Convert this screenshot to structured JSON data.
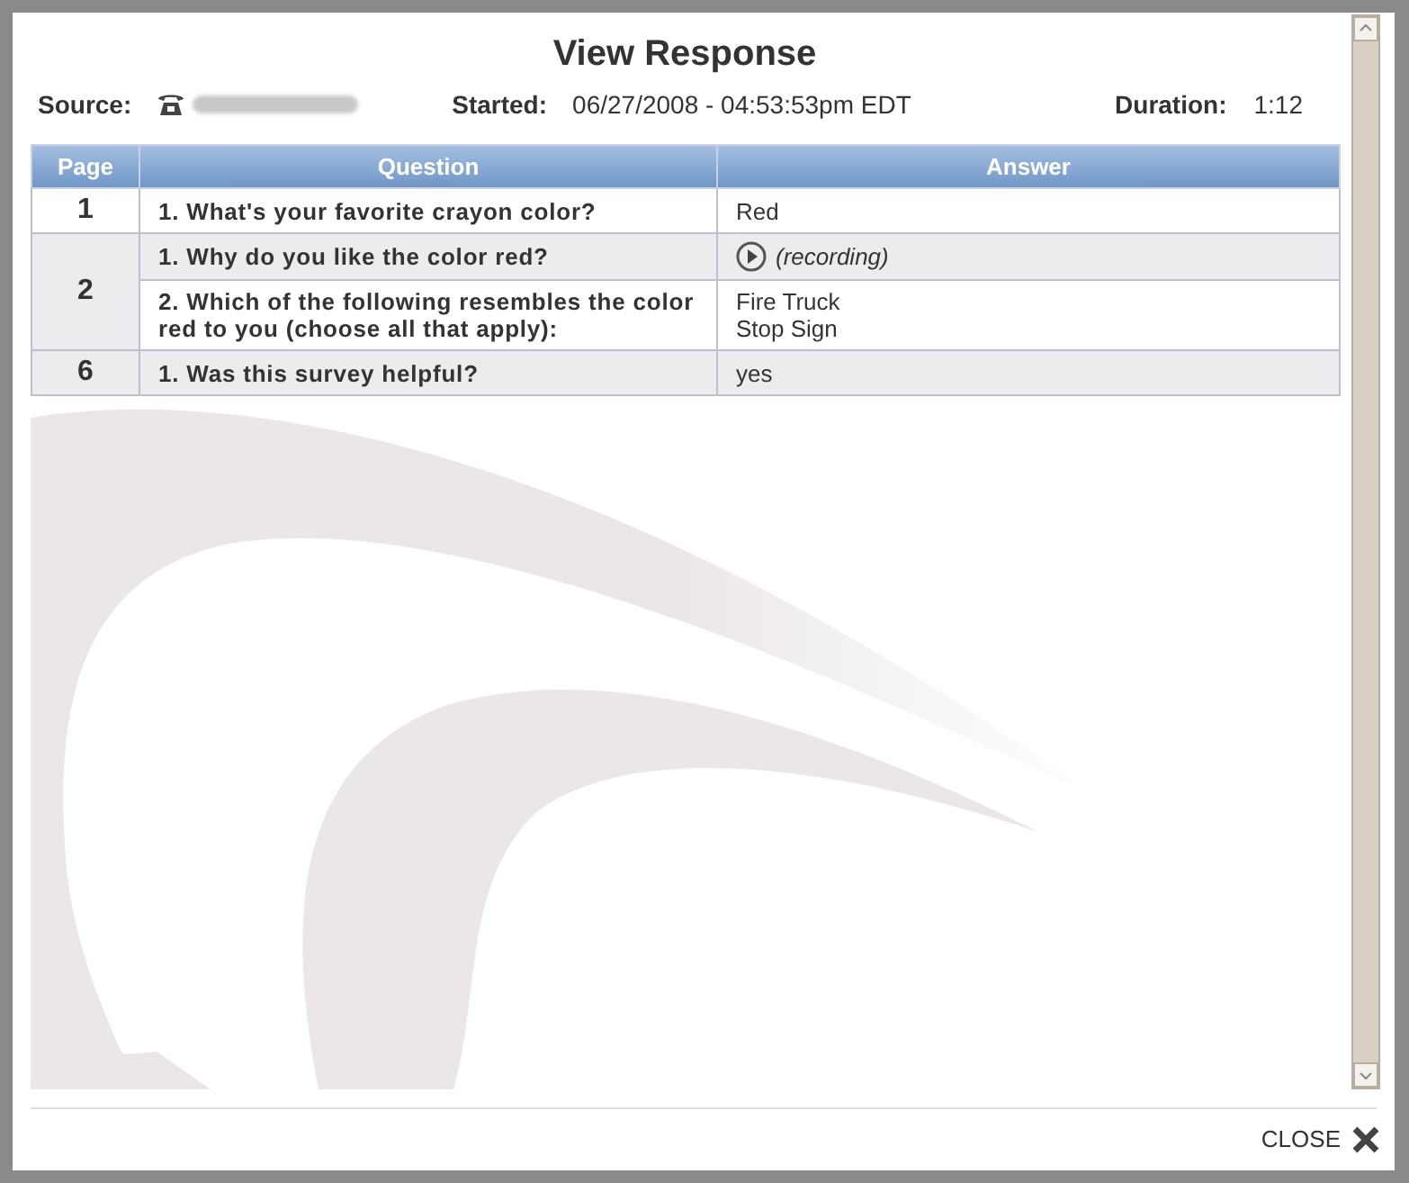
{
  "dialog": {
    "title": "View Response",
    "source_label": "Source:",
    "started_label": "Started:",
    "started": "06/27/2008 - 04:53:53pm EDT",
    "duration_label": "Duration:",
    "duration": "1:12",
    "close": "CLOSE"
  },
  "table": {
    "columns": [
      "Page",
      "Question",
      "Answer"
    ],
    "pages": [
      {
        "page": "1",
        "items": [
          {
            "question": "1. What's your favorite crayon color?",
            "answer": {
              "kind": "text",
              "lines": [
                "Red"
              ]
            }
          }
        ]
      },
      {
        "page": "2",
        "items": [
          {
            "question": "1. Why do you like the color red?",
            "answer": {
              "kind": "recording",
              "text": "(recording)"
            }
          },
          {
            "question": "2. Which of the following resembles the color red to you (choose all that apply):",
            "answer": {
              "kind": "text",
              "lines": [
                "Fire Truck",
                "Stop Sign"
              ]
            }
          }
        ]
      },
      {
        "page": "6",
        "items": [
          {
            "question": "1. Was this survey helpful?",
            "answer": {
              "kind": "text",
              "lines": [
                "yes"
              ]
            }
          }
        ]
      }
    ]
  }
}
